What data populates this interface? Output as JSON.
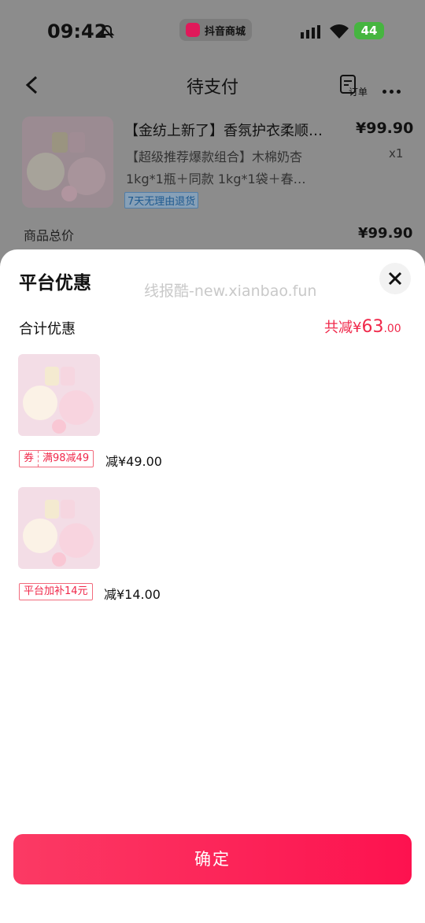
{
  "status_bar": {
    "time": "09:42",
    "app_name": "抖音商城",
    "battery": "44"
  },
  "nav": {
    "title": "待支付",
    "order_label": "订单"
  },
  "product": {
    "title": "【金纺上新了】香氛护衣柔顺…",
    "price": "¥99.90",
    "spec": "【超级推荐爆款组合】木棉奶杏",
    "qty": "x1",
    "spec2": "1kg*1瓶＋同款 1kg*1袋＋春…",
    "return_badge": "7天无理由退货",
    "total_label": "商品总价",
    "total_value": "¥99.90"
  },
  "sheet": {
    "title": "平台优惠",
    "watermark": "线报酷-new.xianbao.fun",
    "summary_label": "合计优惠",
    "summary_prefix": "共减",
    "summary_currency": "¥",
    "summary_int": "63",
    "summary_dec": ".00",
    "items": [
      {
        "tag_type": "券",
        "tag_text": "满98减49",
        "reduce_text": "减¥49.00"
      },
      {
        "tag_type": "",
        "tag_text": "平台加补14元",
        "reduce_text": "减¥14.00"
      }
    ],
    "confirm_label": "确定"
  },
  "colors": {
    "accent": "#f0284a",
    "button": "#fd1f56",
    "battery": "#46b540"
  }
}
